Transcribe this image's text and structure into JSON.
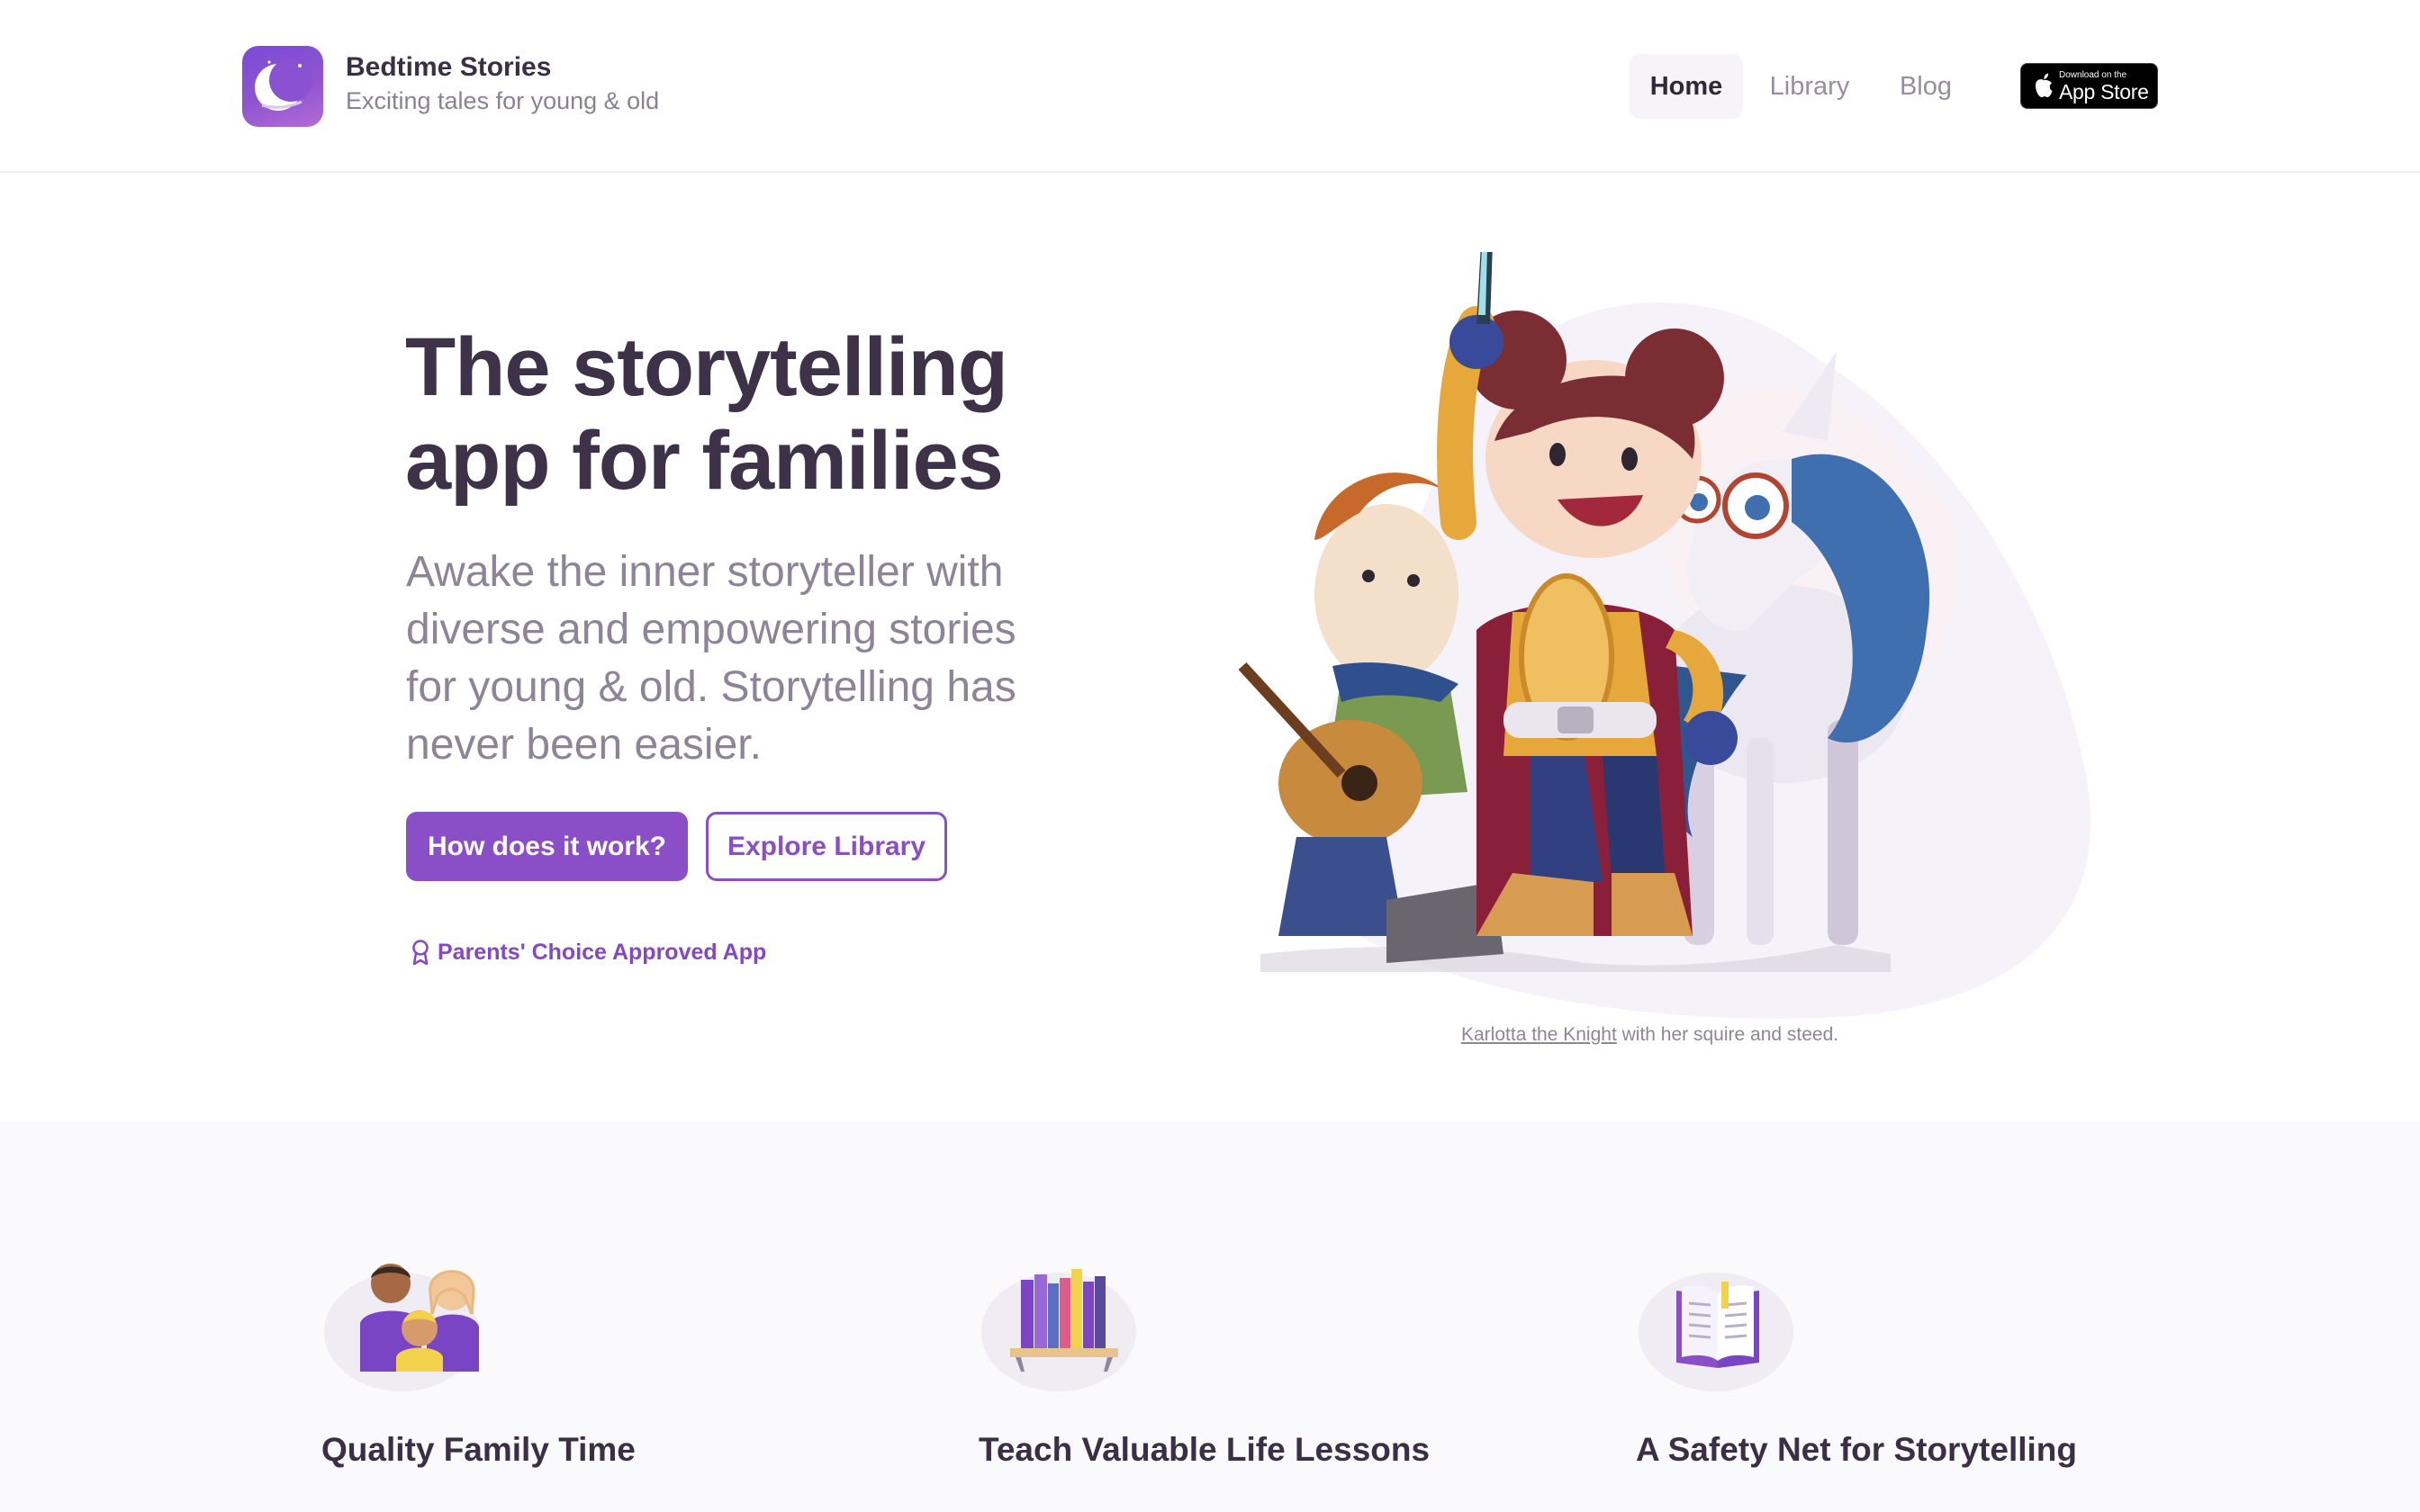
{
  "header": {
    "brand_name": "Bedtime Stories",
    "brand_tagline": "Exciting tales for young & old",
    "logo_icon": "crescent-moon-icon",
    "nav": [
      {
        "label": "Home",
        "active": true
      },
      {
        "label": "Library",
        "active": false
      },
      {
        "label": "Blog",
        "active": false
      }
    ],
    "app_store": {
      "small_text": "Download on the",
      "big_text": "App Store",
      "icon": "apple-icon"
    }
  },
  "hero": {
    "title_line1": "The storytelling",
    "title_line2": "app for families",
    "subtitle": "Awake the inner storyteller with diverse and empowering stories for young & old. Storytelling has never been easier.",
    "primary_button": "How does it work?",
    "secondary_button": "Explore Library",
    "award_text": "Parents' Choice Approved App",
    "award_icon": "ribbon-award-icon",
    "caption_link": "Karlotta the Knight",
    "caption_rest": " with her squire and steed."
  },
  "features": [
    {
      "title": "Quality Family Time",
      "icon": "family-icon"
    },
    {
      "title": "Teach Valuable Life Lessons",
      "icon": "bookshelf-icon"
    },
    {
      "title": "A Safety Net for Storytelling",
      "icon": "open-book-icon"
    }
  ],
  "colors": {
    "brand_purple": "#8a4fc7",
    "title_dark": "#3d3247",
    "subtitle_grey": "#8d8497",
    "feature_bg": "#faf9fc"
  }
}
